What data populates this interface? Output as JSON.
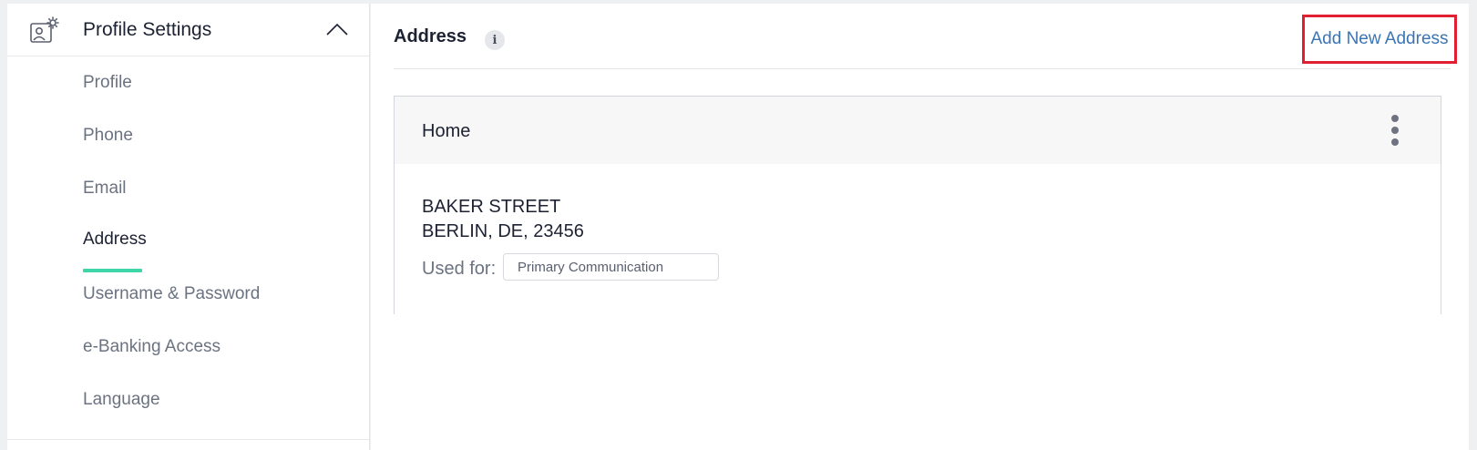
{
  "sidebar": {
    "header_title": "Profile Settings",
    "header_icon": "profile-settings-icon",
    "items": [
      {
        "label": "Profile"
      },
      {
        "label": "Phone"
      },
      {
        "label": "Email"
      },
      {
        "label": "Address"
      },
      {
        "label": "Username & Password"
      },
      {
        "label": "e-Banking Access"
      },
      {
        "label": "Language"
      }
    ],
    "active_item": "Address",
    "accent_color": "#3ed6a8"
  },
  "main": {
    "title": "Address",
    "info_icon": "i",
    "add_button_label": "Add New Address",
    "add_button_color": "#3b74b6",
    "highlight_color": "#e02030",
    "card": {
      "title": "Home",
      "address_line1": "BAKER STREET",
      "address_line2": "BERLIN, DE, 23456",
      "used_for_label": "Used for:",
      "used_for_value": "Primary Communication"
    }
  }
}
